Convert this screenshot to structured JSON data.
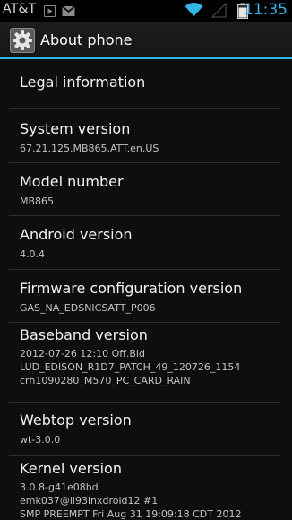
{
  "status_bar": {
    "carrier": "AT&T",
    "time": "11:35",
    "icons": [
      "play-store-notification-icon",
      "gmail-notification-icon",
      "wifi-icon",
      "battery-icon",
      "signal-icon"
    ]
  },
  "action_bar": {
    "icon": "settings-gear-icon",
    "title": "About phone"
  },
  "items": [
    {
      "label": "Legal information"
    },
    {
      "label": "System version",
      "value": "67.21.125.MB865.ATT.en.US"
    },
    {
      "label": "Model number",
      "value": "MB865"
    },
    {
      "label": "Android version",
      "value": "4.0.4"
    },
    {
      "label": "Firmware configuration version",
      "value": "GAS_NA_EDSNICSATT_P006"
    },
    {
      "label": "Baseband version",
      "value": "2012-07-26 12:10 Off.Bld\nLUD_EDISON_R1D7_PATCH_49_120726_1154\ncrh1090280_M570_PC_CARD_RAIN"
    },
    {
      "label": "Webtop version",
      "value": "wt-3.0.0"
    },
    {
      "label": "Kernel version",
      "value": "3.0.8-g41e08bd\nemk037@il93lnxdroid12 #1\nSMP PREEMPT Fri Aug 31 19:09:18 CDT 2012"
    }
  ],
  "colors": {
    "accent": "#33b5e5",
    "background": "#0e0e0e",
    "primary_text": "#f2f2f2",
    "secondary_text": "#c2c2c2"
  }
}
